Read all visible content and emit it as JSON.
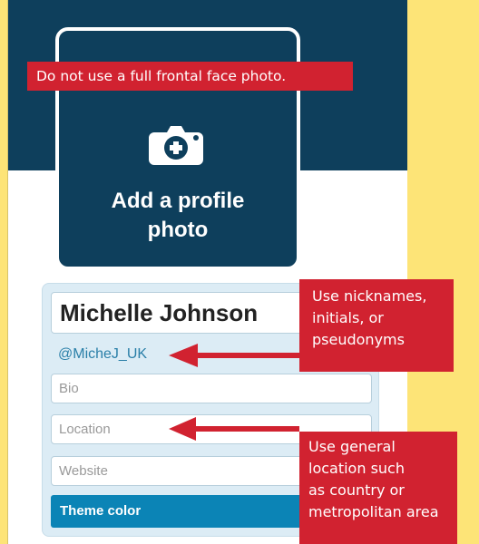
{
  "profile_photo": {
    "label_line1": "Add a profile",
    "label_line2": "photo",
    "icon": "camera-add-icon"
  },
  "form": {
    "name_value": "Michelle Johnson",
    "handle": "@MicheJ_UK",
    "bio_placeholder": "Bio",
    "location_placeholder": "Location",
    "website_placeholder": "Website",
    "theme_button_label": "Theme color"
  },
  "annotations": {
    "face_photo_note": "Do not use a full frontal face photo.",
    "nickname_note": [
      "Use nicknames,",
      "initials, or",
      "pseudonyms"
    ],
    "location_note": [
      "Use general",
      "location such",
      "as country or",
      "metropolitan area"
    ]
  },
  "colors": {
    "background": "#fde477",
    "header": "#0e3f5c",
    "note_red": "#d12230",
    "theme_blue": "#0b84b6",
    "handle_blue": "#2a7fa8"
  }
}
